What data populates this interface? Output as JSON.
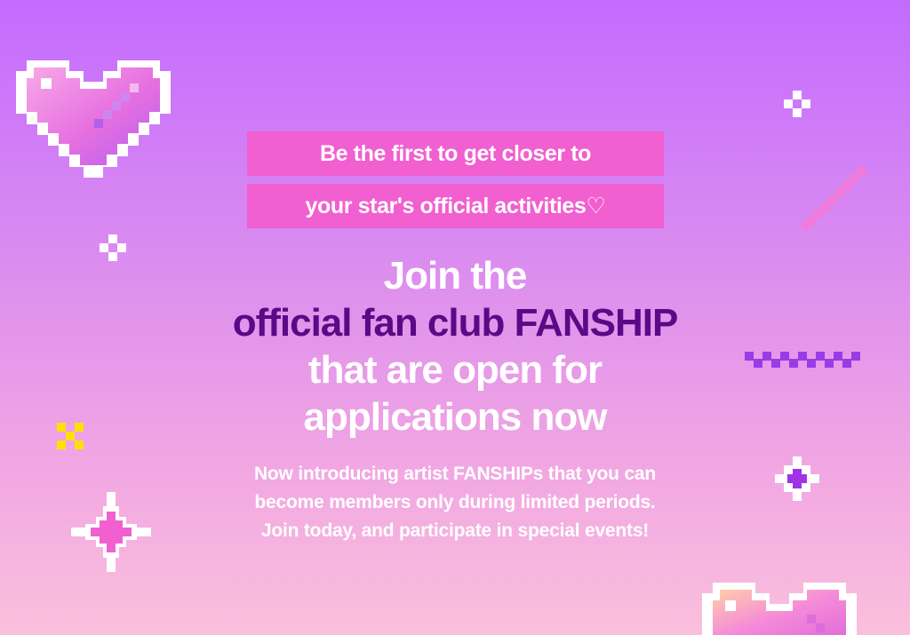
{
  "banner": {
    "tagline_line1": "Be the first to get closer to",
    "tagline_line2": "your star's official activities♡",
    "headline_line1": "Join the",
    "headline_line2": "official fan club FANSHIP",
    "headline_line3": "that are open for",
    "headline_line4": "applications now",
    "body_line1": "Now introducing artist FANSHIPs that you can",
    "body_line2": "become members only during limited periods.",
    "body_line3": "Join today, and participate in special events!"
  },
  "colors": {
    "background_top": "#c46bff",
    "background_bottom": "#f9c0dc",
    "tagline_box": "#f15fd0",
    "headline_accent": "#5a0a86",
    "text": "#ffffff"
  },
  "decorations": [
    "pixel-heart-icon",
    "sparkle-icon",
    "pixel-dash-icon"
  ]
}
